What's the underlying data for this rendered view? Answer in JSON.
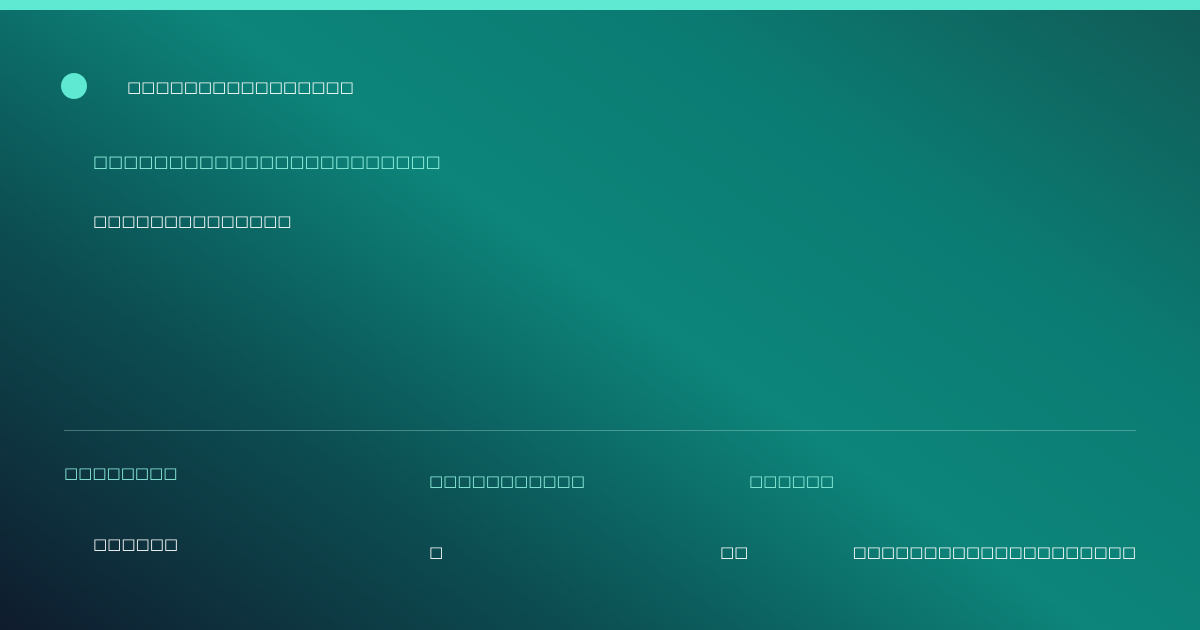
{
  "brand": {
    "name": "□□□□□□□□□□□□□□□□"
  },
  "hero": {
    "headline": "□□□□□□□□□□□□□□□□□□□□□□□",
    "subline": "□□□□□□□□□□□□□□"
  },
  "stats": [
    {
      "label": "□□□□□□□□",
      "value": "□□□□□□"
    },
    {
      "label": "□□□□□□□□□□□",
      "value": "□"
    },
    {
      "label": "□□□□□□",
      "value": "□□"
    },
    {
      "label": "",
      "value": "□□□□□□□□□□□□□□□□□□□□"
    }
  ],
  "colors": {
    "accent": "#5fe8d2",
    "accent_text": "#8ff0df",
    "background_dark": "#0f1b2d",
    "background_teal": "#0d857a"
  }
}
